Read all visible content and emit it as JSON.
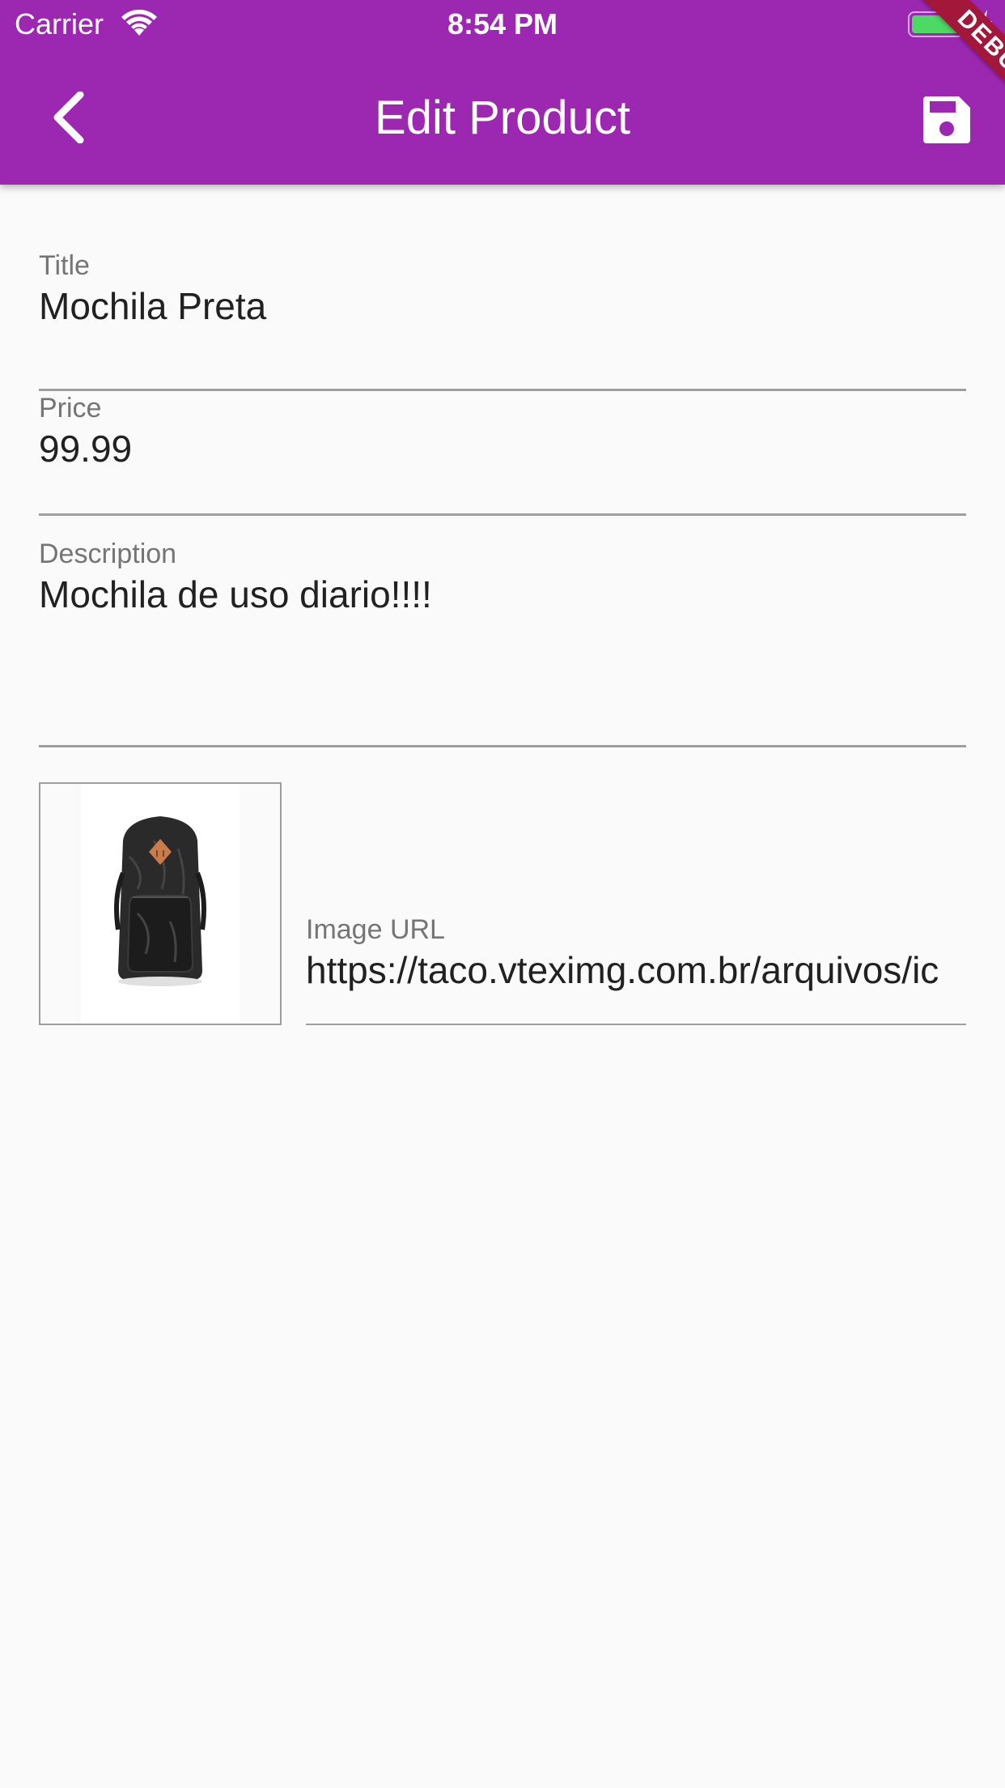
{
  "status_bar": {
    "carrier": "Carrier",
    "time": "8:54 PM"
  },
  "app_bar": {
    "title": "Edit Product",
    "background_color": "#9c27b0",
    "back_icon": "chevron-left-icon",
    "save_icon": "save-floppy-icon",
    "debug_banner": "DEBUG"
  },
  "form": {
    "title": {
      "label": "Title",
      "value": "Mochila Preta"
    },
    "price": {
      "label": "Price",
      "value": "99.99"
    },
    "description": {
      "label": "Description",
      "value": "Mochila de uso diario!!!!"
    },
    "image_url": {
      "label": "Image URL",
      "value": "https://taco.vteximg.com.br/arquivos/ic"
    }
  },
  "image_preview": {
    "subject": "black backpack"
  }
}
